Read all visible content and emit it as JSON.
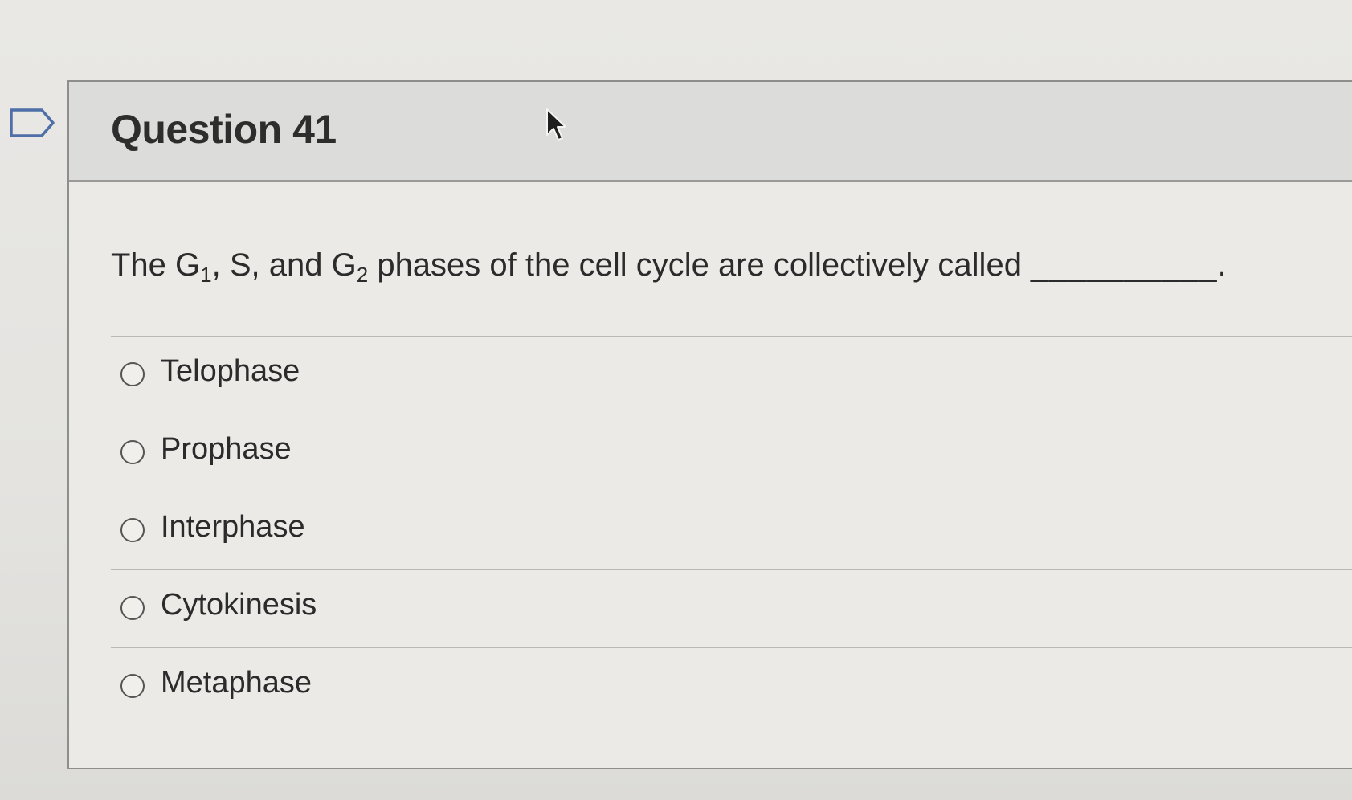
{
  "question": {
    "title": "Question 41",
    "text_part1": "The G",
    "sub1": "1",
    "text_part2": ", S, and G",
    "sub2": "2",
    "text_part3": " phases of the cell cycle are collectively called ",
    "blank": "__________",
    "period": "."
  },
  "answers": [
    {
      "label": "Telophase"
    },
    {
      "label": "Prophase"
    },
    {
      "label": "Interphase"
    },
    {
      "label": "Cytokinesis"
    },
    {
      "label": "Metaphase"
    }
  ],
  "icons": {
    "flag": "flag-icon",
    "cursor": "cursor-arrow-icon"
  },
  "colors": {
    "header_bg": "#dcdcda",
    "text": "#2b2b2b",
    "border": "#8e8e8c"
  }
}
